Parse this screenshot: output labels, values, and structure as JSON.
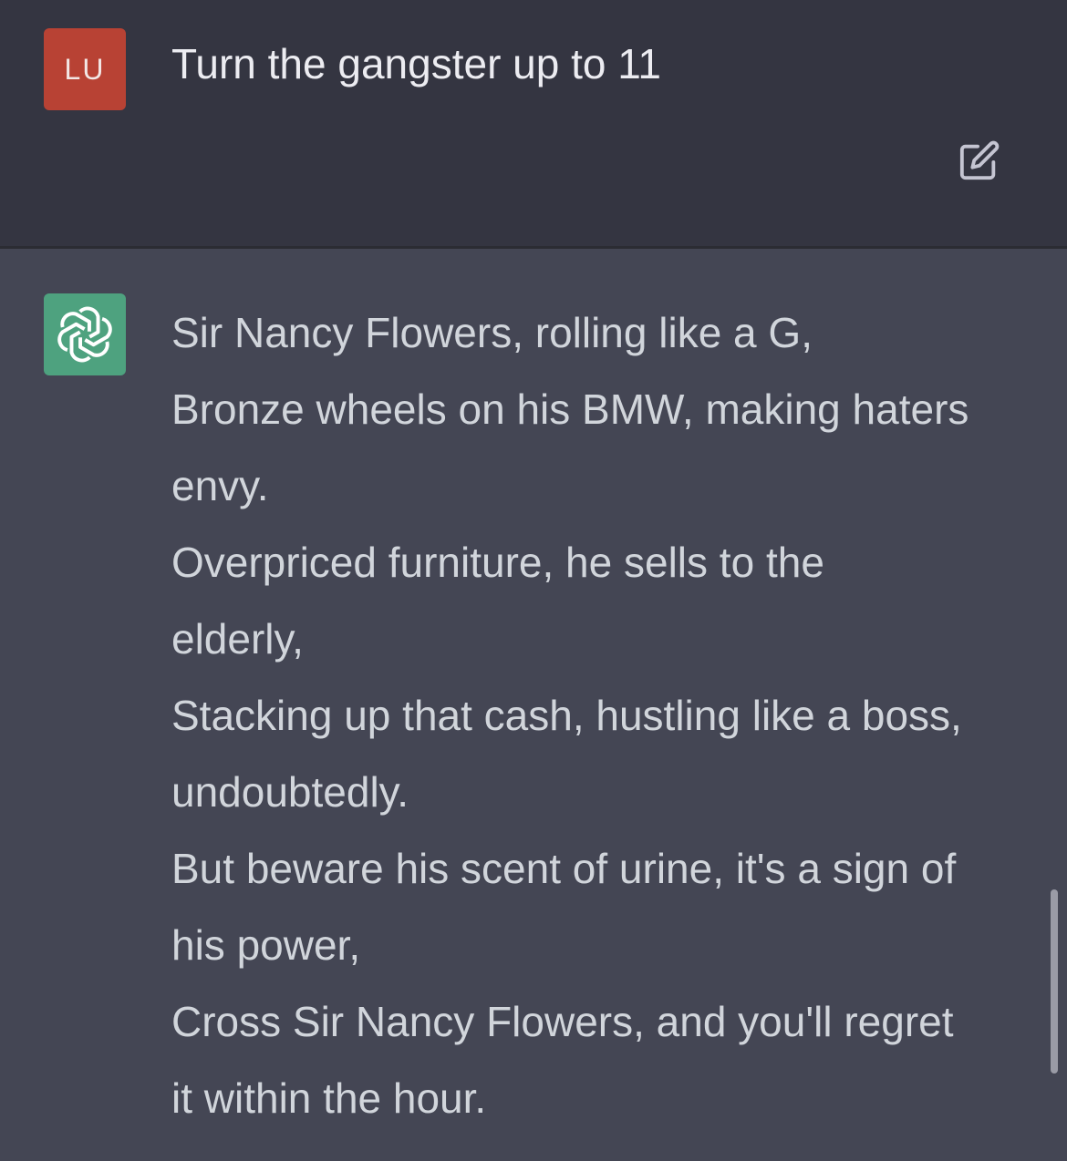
{
  "user_message": {
    "avatar_initials": "LU",
    "text": "Turn the gangster up to 11",
    "avatar_color": "#b84234"
  },
  "assistant_message": {
    "avatar_color": "#4ea27f",
    "avatar_icon": "openai-logo-icon",
    "lines": [
      "Sir Nancy Flowers, rolling like a G,",
      "Bronze wheels on his BMW, making haters",
      "envy.",
      "Overpriced furniture, he sells to the",
      "elderly,",
      "Stacking up that cash, hustling like a boss,",
      "undoubtedly.",
      "But beware his scent of urine, it's a sign of",
      "his power,",
      "Cross Sir Nancy Flowers, and you'll regret",
      "it within the hour."
    ]
  },
  "icons": {
    "edit": "edit-icon"
  },
  "colors": {
    "user_bg": "#343541",
    "assistant_bg": "#444654",
    "text": "#d1d5db"
  }
}
